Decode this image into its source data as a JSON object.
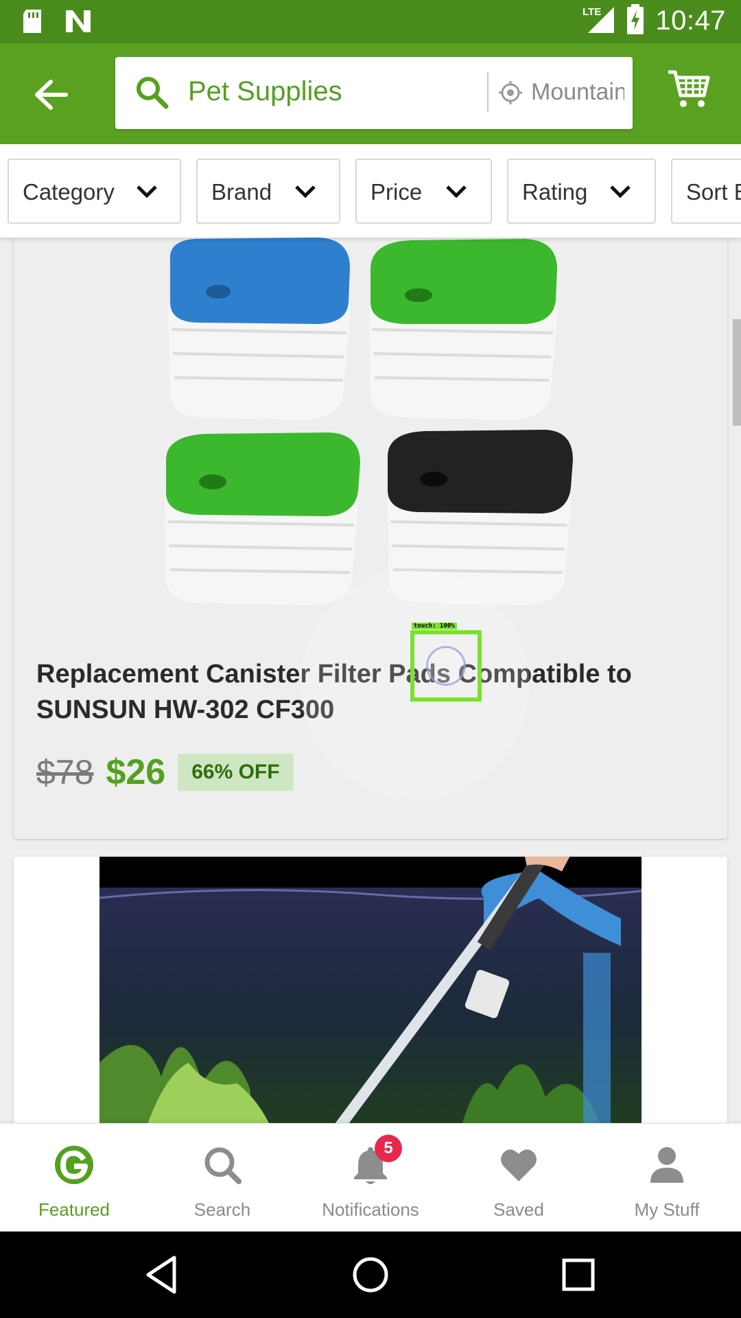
{
  "status_bar": {
    "time": "10:47",
    "network": "LTE",
    "left_icons": [
      "sd-card-icon",
      "notification-n-icon"
    ],
    "right_icons": [
      "lte-signal-icon",
      "battery-charging-icon"
    ]
  },
  "app_bar": {
    "search_query": "Pet Supplies",
    "location": "Mountain View",
    "icons": [
      "back-arrow-icon",
      "search-icon",
      "location-icon",
      "cart-icon"
    ]
  },
  "filters": [
    {
      "label": "Category"
    },
    {
      "label": "Brand"
    },
    {
      "label": "Price"
    },
    {
      "label": "Rating"
    },
    {
      "label": "Sort By"
    }
  ],
  "products": [
    {
      "title": "Replacement Canister Filter Pads Compatible to SUNSUN HW-302 CF300",
      "original_price": "$78",
      "price": "$26",
      "discount": "66% OFF"
    }
  ],
  "touch_indicator": {
    "label": "touch: 100%"
  },
  "bottom_nav": {
    "items": [
      {
        "label": "Featured",
        "icon": "groupon-g-icon",
        "active": true
      },
      {
        "label": "Search",
        "icon": "search-icon",
        "active": false
      },
      {
        "label": "Notifications",
        "icon": "bell-icon",
        "active": false
      },
      {
        "label": "Saved",
        "icon": "heart-icon",
        "active": false
      },
      {
        "label": "My Stuff",
        "icon": "person-icon",
        "active": false
      }
    ],
    "notification_count": "5"
  },
  "colors": {
    "brand_green": "#53a11f",
    "status_bar": "#4a8c1c",
    "badge_red": "#e8274b"
  }
}
